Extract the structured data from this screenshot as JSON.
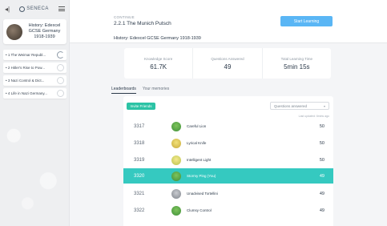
{
  "sidebar": {
    "logo_text": "SENECA",
    "course_title": "History: Edexcel GCSE Germany 1918-1939",
    "sections": [
      {
        "label": "• 1 The Weimar Republ..."
      },
      {
        "label": "• 2 Hitler's Rise to Pow..."
      },
      {
        "label": "• 3 Nazi Control & Dict..."
      },
      {
        "label": "• 4 Life in Nazi Germany..."
      }
    ]
  },
  "header": {
    "continue_label": "CONTINUE",
    "continue_title": "2.2.1 The Munich Putsch",
    "start_button": "Start Learning",
    "course_path": "History: Edexcel GCSE Germany 1918-1939"
  },
  "stats": [
    {
      "label": "Knowledge Score",
      "value": "61.7K"
    },
    {
      "label": "Questions Answered",
      "value": "49"
    },
    {
      "label": "Total Learning Time",
      "value": "5min 15s"
    }
  ],
  "tabs": [
    {
      "label": "Leaderboards"
    },
    {
      "label": "Your memories"
    }
  ],
  "leaderboard": {
    "invite_button": "Invite Friends",
    "sort_select": "Questions answered",
    "note": "Last updated: 6mins ago",
    "rows": [
      {
        "rank": "3317",
        "name": "Careful Lion",
        "score": "50",
        "avatar": "lion-avatar-icon"
      },
      {
        "rank": "3318",
        "name": "Lyrical Knife",
        "score": "50",
        "avatar": "knife-avatar-icon"
      },
      {
        "rank": "3319",
        "name": "Intelligent Light",
        "score": "50",
        "avatar": "light-avatar-icon"
      },
      {
        "rank": "3320",
        "name": "Stormy Ping (You)",
        "score": "49",
        "avatar": "ping-avatar-icon",
        "me": true
      },
      {
        "rank": "3321",
        "name": "Unadvised Tortellini",
        "score": "49",
        "avatar": "tortellini-avatar-icon"
      },
      {
        "rank": "3322",
        "name": "Clumsy Control",
        "score": "49",
        "avatar": "control-avatar-icon"
      }
    ]
  },
  "colors": {
    "accent_blue": "#5ab6f5",
    "accent_green": "#2cc3a5",
    "highlight_row": "#35c9c0"
  }
}
